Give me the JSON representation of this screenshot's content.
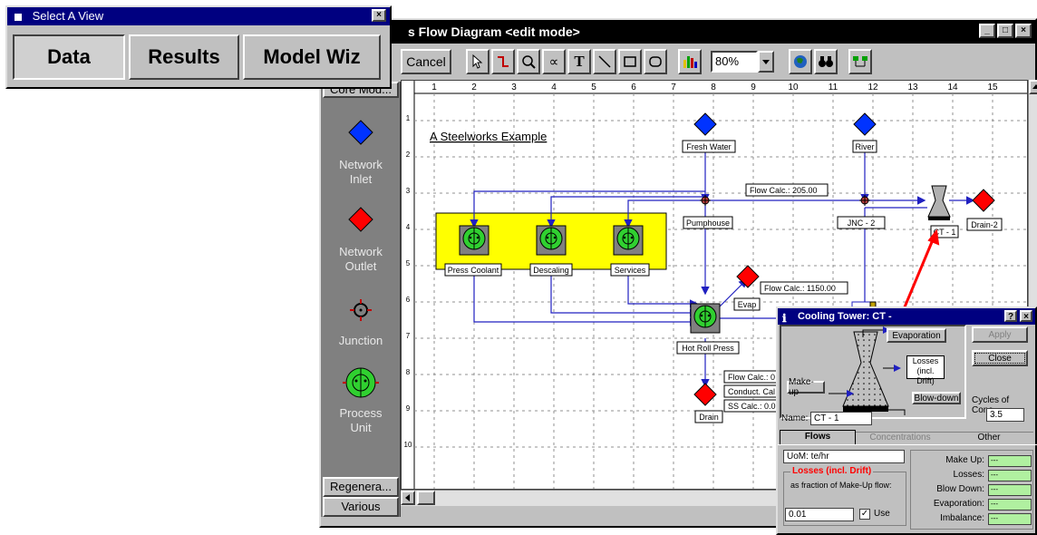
{
  "select_view": {
    "title": "Select A View",
    "buttons": [
      "Data",
      "Results",
      "Model Wiz"
    ]
  },
  "main_window": {
    "title": "s Flow Diagram <edit mode>",
    "toolbar": {
      "cancel_label": "Cancel",
      "zoom_value": "80%",
      "icons": [
        "pointer-icon",
        "connector-icon",
        "zoom-icon",
        "formula-icon",
        "text-icon",
        "line-icon",
        "rectangle-icon",
        "rounded-rect-icon",
        "chart-icon",
        "globe-icon",
        "binoculars-icon",
        "network-icon"
      ]
    },
    "palette": {
      "top_tab": "Core Mod...",
      "items": [
        {
          "label_lines": [
            "Network",
            "Inlet"
          ],
          "icon": "blue-diamond-icon"
        },
        {
          "label_lines": [
            "Network",
            "Outlet"
          ],
          "icon": "red-diamond-icon"
        },
        {
          "label_lines": [
            "Junction"
          ],
          "icon": "junction-icon"
        },
        {
          "label_lines": [
            "Process",
            "Unit"
          ],
          "icon": "process-unit-icon"
        }
      ],
      "bottom_tabs": [
        "Regenera...",
        "Various"
      ]
    },
    "ruler_numbers": [
      "1",
      "2",
      "3",
      "4",
      "5",
      "6",
      "7",
      "8",
      "9",
      "10",
      "11",
      "12",
      "13",
      "14",
      "15"
    ],
    "row_numbers": [
      "1",
      "2",
      "3",
      "4",
      "5",
      "6",
      "7",
      "8",
      "9",
      "10"
    ],
    "diagram": {
      "heading": "A Steelworks Example",
      "nodes": {
        "fresh_water": "Fresh Water",
        "river": "River",
        "pumphouse": "Pumphouse",
        "jnc2": "JNC - 2",
        "ct1": "CT - 1",
        "drain2": "Drain-2",
        "press_coolant": "Press Coolant",
        "descaling": "Descaling",
        "services": "Services",
        "evap": "Evap",
        "hot_roll_press": "Hot Roll Press",
        "drain": "Drain"
      },
      "callouts": {
        "flow_calc_1": "Flow Calc.: 205.00",
        "flow_calc_2": "Flow Calc.: 1150.00",
        "flow_calc_3": "Flow Calc.: 0",
        "conduct_calc": "Conduct. Cal",
        "ss_calc": "SS Calc.: 0.0"
      }
    }
  },
  "cooling_tower": {
    "title": "Cooling Tower: CT -",
    "apply_label": "Apply",
    "close_label": "Close",
    "diagram_labels": {
      "evaporation": "Evaporation",
      "losses_line1": "Losses",
      "losses_line2": "(incl. Drift)",
      "makeup": "Make-up",
      "blowdown": "Blow-down"
    },
    "cycles_label": "Cycles of Conc.",
    "cycles_value": "3.5",
    "name_label": "Name:",
    "name_value": "CT - 1",
    "tabs": [
      "Flows",
      "Concentrations",
      "Other"
    ],
    "uom_value": "UoM: te/hr",
    "losses_group_title": "Losses (incl. Drift)",
    "losses_fraction_label": "as fraction of Make-Up flow:",
    "losses_fraction_value": "0.01",
    "use_label": "Use",
    "use_checked": true,
    "results": [
      {
        "label": "Make Up:",
        "value": "---"
      },
      {
        "label": "Losses:",
        "value": "---"
      },
      {
        "label": "Blow Down:",
        "value": "---"
      },
      {
        "label": "Evaporation:",
        "value": "---"
      },
      {
        "label": "Imbalance:",
        "value": "---"
      }
    ]
  },
  "colors": {
    "inlet": "#0033ff",
    "outlet": "#ff0000",
    "flow_line": "#2020c0",
    "process_fill": "#30d030",
    "area_highlight": "#ffff00",
    "link_arrow": "#ff0000",
    "title_bar": "#000080"
  }
}
